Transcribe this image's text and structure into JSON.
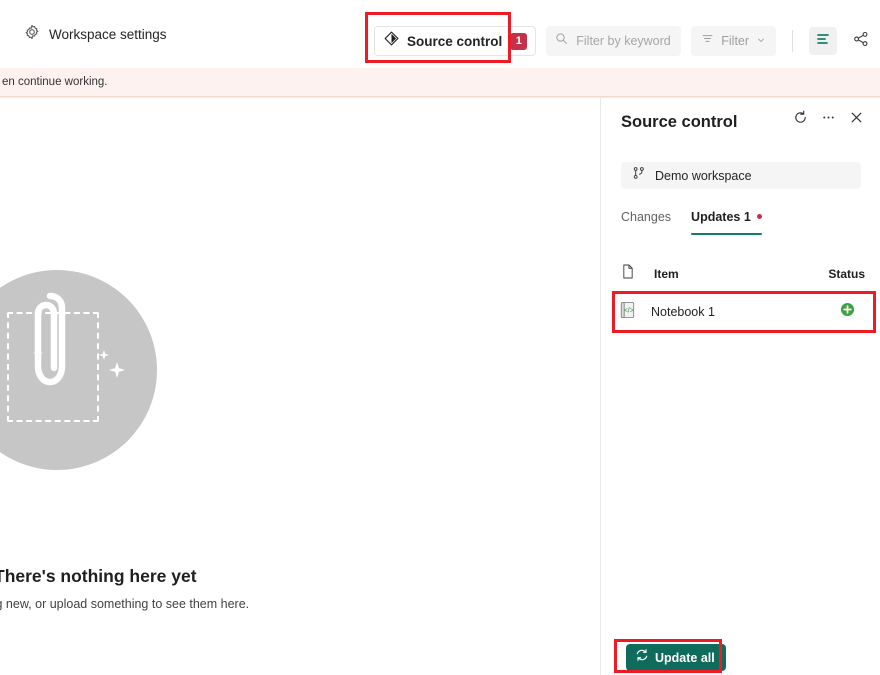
{
  "toolbar": {
    "workspace_settings_label": "Workspace settings",
    "workspace_settings_icon": "gear-icon",
    "source_control_label": "Source control",
    "source_control_icon": "git-diamond-icon",
    "source_control_badge": "1",
    "keyword_placeholder": "Filter by keyword",
    "keyword_value": "",
    "keyword_icon": "search-icon",
    "filter_label": "Filter",
    "filter_icon": "filter-lines-icon",
    "filter_chevron_icon": "chevron-down-icon",
    "list_view_icon": "list-view-icon",
    "lineage_view_icon": "share-lineage-icon"
  },
  "banner": {
    "text": "en continue working."
  },
  "main": {
    "empty_state": {
      "art_icon": "paperclip-upload-illustration",
      "title": "There's nothing here yet",
      "subtitle": "iing new, or upload something to see them here."
    }
  },
  "panel": {
    "title": "Source control",
    "refresh_icon": "refresh-icon",
    "more_icon": "ellipsis-icon",
    "close_icon": "close-icon",
    "workspace_chip": {
      "label": "Demo workspace",
      "icon": "branch-icon"
    },
    "tabs": [
      {
        "label": "Changes",
        "active": false,
        "dot": false
      },
      {
        "label": "Updates 1",
        "active": true,
        "dot": true
      }
    ],
    "table": {
      "header_icon": "file-icon",
      "columns": [
        "Item",
        "Status"
      ],
      "rows": [
        {
          "icon": "notebook-icon",
          "name": "Notebook 1",
          "status_icon": "added-plus-icon",
          "status_color": "#3fa142"
        }
      ]
    },
    "update_all": {
      "label": "Update all",
      "icon": "sync-icon"
    }
  },
  "colors": {
    "accent_teal": "#107c6e",
    "button_green": "#0f6c5d",
    "badge_red": "#c4314b",
    "annotation_red": "#ee1b24",
    "status_green": "#3fa142",
    "banner_bg": "#fdf2ef"
  },
  "annotations": [
    {
      "name": "source-control-button-highlight"
    },
    {
      "name": "notebook-row-highlight"
    },
    {
      "name": "update-all-button-highlight"
    }
  ]
}
